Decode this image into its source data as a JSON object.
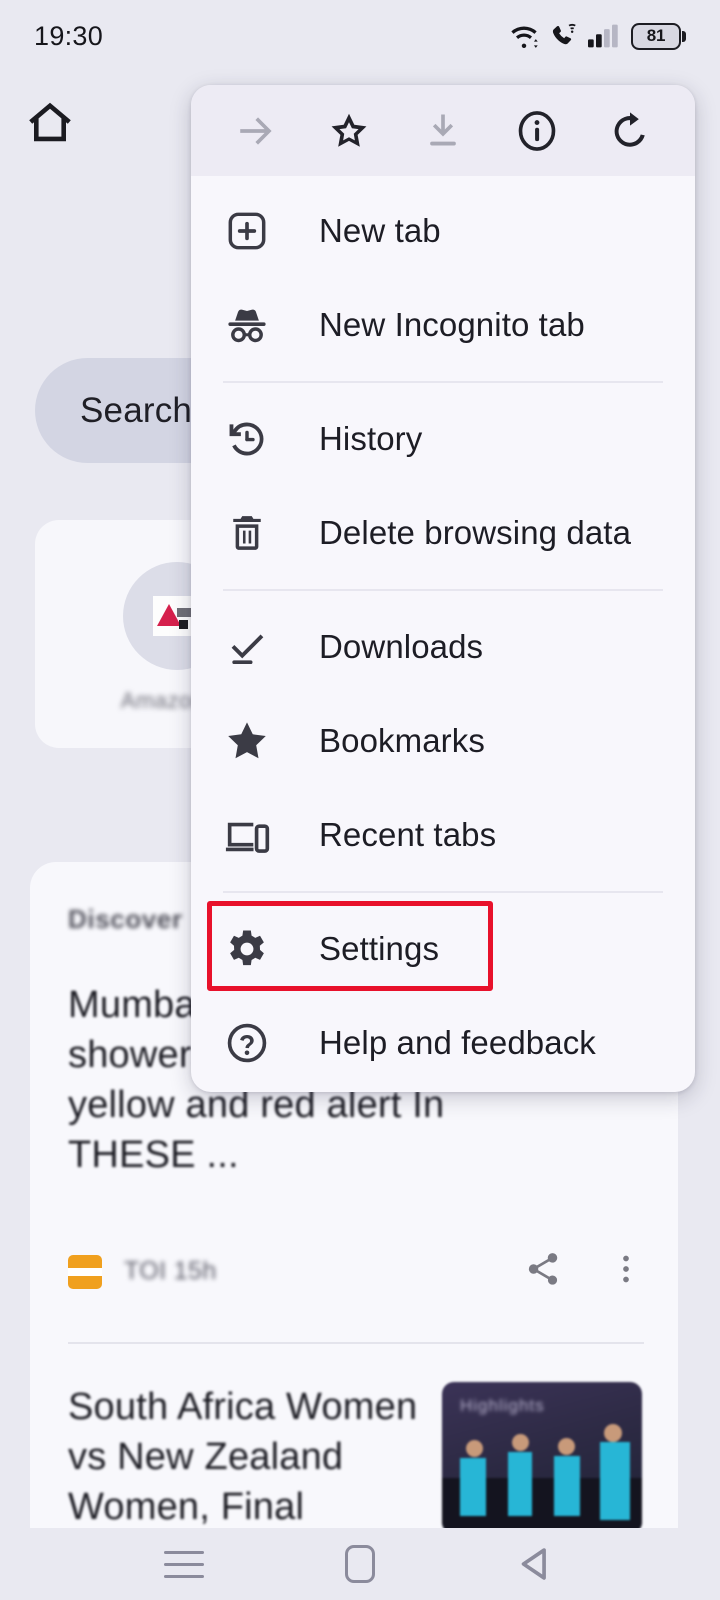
{
  "status_bar": {
    "clock": "19:30",
    "battery_percent": "81",
    "icons": [
      "wifi-icon",
      "vowifi-call-icon",
      "cellular-signal-icon",
      "battery-icon"
    ]
  },
  "page": {
    "home_icon": "home-icon",
    "search_bar": {
      "label": "Search"
    },
    "shortcut": {
      "label": "Amazon.in",
      "favicon": "amazon-favicon"
    },
    "feed": {
      "header": "Discover",
      "articles": [
        {
          "title": "Mumbai rains: Heavy showers last of the issues yellow and red alert In THESE ...",
          "source": "TOI  15h",
          "source_logo": "toi-logo",
          "share_icon": "share-icon",
          "more_icon": "more-vertical-icon"
        },
        {
          "title": "South Africa Women vs New Zealand Women, Final",
          "thumb_caption": "Highlights"
        }
      ]
    }
  },
  "menu": {
    "toolbar": [
      {
        "name": "forward-arrow-icon",
        "label": "Forward",
        "disabled": true
      },
      {
        "name": "star-outline-icon",
        "label": "Bookmark this page",
        "disabled": false
      },
      {
        "name": "download-icon",
        "label": "Download page",
        "disabled": true
      },
      {
        "name": "page-info-icon",
        "label": "Page info",
        "disabled": false
      },
      {
        "name": "reload-icon",
        "label": "Reload",
        "disabled": false
      }
    ],
    "groups": [
      {
        "items": [
          {
            "label": "New tab",
            "icon": "new-tab-plus-icon"
          },
          {
            "label": "New Incognito tab",
            "icon": "incognito-icon"
          }
        ]
      },
      {
        "items": [
          {
            "label": "History",
            "icon": "history-clock-icon"
          },
          {
            "label": "Delete browsing data",
            "icon": "trash-icon"
          }
        ]
      },
      {
        "items": [
          {
            "label": "Downloads",
            "icon": "downloads-check-icon"
          },
          {
            "label": "Bookmarks",
            "icon": "star-filled-icon"
          },
          {
            "label": "Recent tabs",
            "icon": "recent-tabs-devices-icon"
          }
        ]
      },
      {
        "items": [
          {
            "label": "Settings",
            "icon": "gear-icon",
            "highlighted": true
          },
          {
            "label": "Help and feedback",
            "icon": "help-circle-icon"
          }
        ]
      }
    ]
  },
  "annotation": {
    "target_label": "Settings",
    "box_color": "#e8112b"
  },
  "nav_bar": {
    "recents_label": "Recent apps",
    "home_label": "Home",
    "back_label": "Back"
  }
}
